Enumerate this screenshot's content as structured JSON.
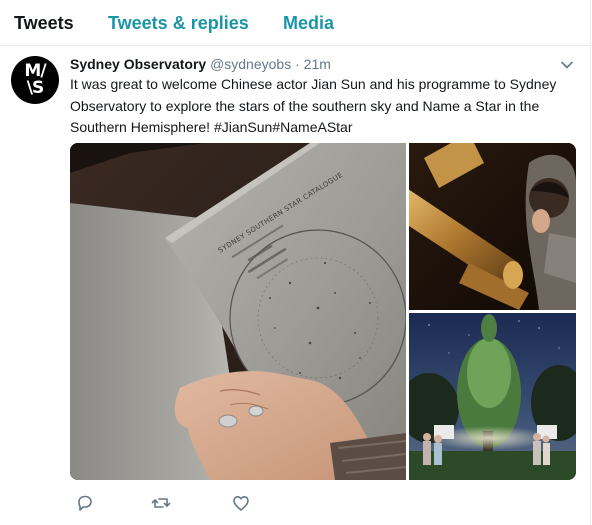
{
  "tabs": [
    {
      "label": "Tweets"
    },
    {
      "label": "Tweets & replies"
    },
    {
      "label": "Media"
    }
  ],
  "tweet": {
    "author_name": "Sydney Observatory",
    "handle": "@sydneyobs",
    "separator": "·",
    "time": "21m",
    "avatar_logo_text": "MAAS",
    "text_lines": [
      "It was great to welcome Chinese actor Jian Sun and his programme to Sydney",
      "Observatory to explore the stars of the southern sky and Name a Star in the",
      "Southern Hemisphere! #JianSun#NameAStar"
    ]
  },
  "media": {
    "catalogue_text": "SYDNEY SOUTHERN STAR CATALOGUE",
    "icons": [
      "reply-icon",
      "retweet-icon",
      "like-icon",
      "chevron-down-icon"
    ]
  },
  "colors": {
    "accent": "#1b95a8",
    "text": "#14171a",
    "muted": "#657786",
    "divider": "#e6ecf0"
  }
}
